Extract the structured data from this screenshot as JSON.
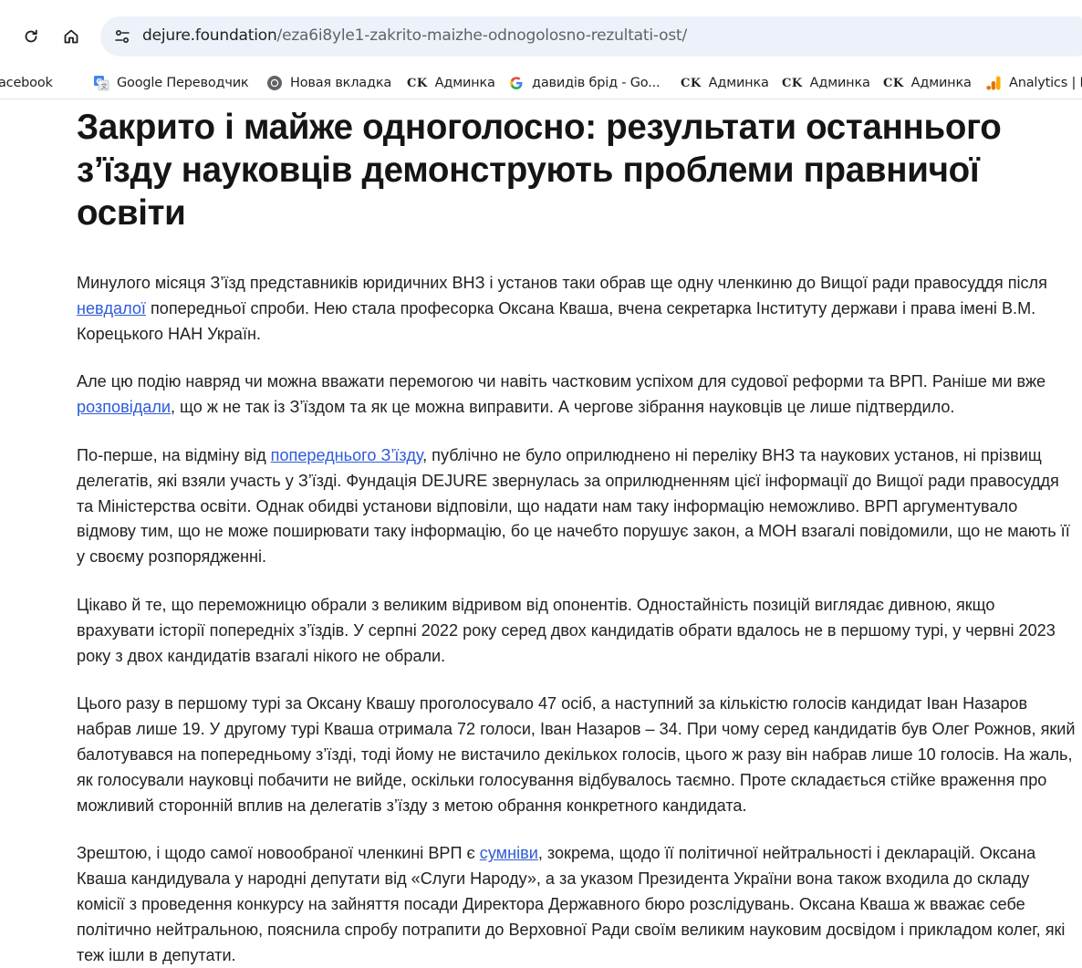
{
  "browser": {
    "url_domain": "dejure.foundation",
    "url_path": "/eza6i8yle1-zakrito-maizhe-odnogolosno-rezultati-ost/",
    "bookmarks": [
      {
        "label": "acebook",
        "icon": "facebook-icon"
      },
      {
        "label": "Google Переводчик",
        "icon": "google-translate-icon"
      },
      {
        "label": "Новая вкладка",
        "icon": "chrome-icon"
      },
      {
        "label": "Админка",
        "icon": "ck-logo-icon",
        "prefix": "CK"
      },
      {
        "label": "давидів брід - Go...",
        "icon": "google-icon"
      },
      {
        "label": "Админка",
        "icon": "ck-logo-icon",
        "prefix": "CK"
      },
      {
        "label": "Админка",
        "icon": "ck-logo-icon",
        "prefix": "CK"
      },
      {
        "label": "Админка",
        "icon": "ck-logo-icon",
        "prefix": "CK"
      },
      {
        "label": "Analytics | F",
        "icon": "analytics-icon"
      }
    ]
  },
  "article": {
    "title": "Закрито і майже одноголосно: результати останнього з’їзду науковців демонструють проблеми правничої освіти",
    "p1": {
      "before": "Минулого місяця З’їзд представників  юридичних ВНЗ і установ таки обрав ще одну членкиню до Вищої ради правосуддя після ",
      "link": "невдалої",
      "after": " попередньої спроби. Нею стала професорка Оксана Кваша, вчена секретарка Інституту держави і права імені В.М. Корецького НАН Україн."
    },
    "p2": {
      "before": "Але цю подію навряд чи можна вважати перемогою чи навіть частковим успіхом для судової реформи та ВРП. Раніше ми вже ",
      "link": "розповідали",
      "after": ", що ж не так із З’їздом та як це можна виправити. А чергове зібрання науковців це лише підтвердило."
    },
    "p3": {
      "before": "По-перше, на відміну від ",
      "link": "попереднього З’їзду",
      "after": ", публічно не було оприлюднено ні переліку ВНЗ та наукових установ, ні прізвищ делегатів, які взяли участь у З’їзді. Фундація DEJURE звернулась за оприлюдненням цієї інформації до Вищої ради правосуддя та Міністерства освіти. Однак обидві установи відповіли, що надати нам таку інформацію неможливо. ВРП аргументувало відмову тим, що не може поширювати таку інформацію, бо це начебто порушує закон, а МОН взагалі повідомили, що не мають її у своєму розпорядженні."
    },
    "p4": "Цікаво й те, що переможницю обрали з великим відривом від опонентів. Одностайність позицій виглядає дивною, якщо врахувати історії попередніх з’їздів. У серпні 2022 року серед двох кандидатів обрати вдалось не в першому турі, у червні 2023 року з двох кандидатів взагалі нікого не обрали.",
    "p5": "Цього разу в першому турі за Оксану Квашу проголосувало 47 осіб, а наступний за кількістю голосів кандидат Іван Назаров набрав лише 19. У другому турі Кваша отримала 72 голоси, Іван Назаров – 34. При чому серед кандидатів був Олег Рожнов, який балотувався на попередньому з’їзді, тоді йому не вистачило декількох голосів, цього ж разу він набрав лише 10 голосів. На жаль, як голосували науковці побачити не вийде, оскільки голосування відбувалось таємно. Проте складається стійке враження про можливий сторонній вплив на делегатів з’їзду з метою обрання конкретного кандидата.",
    "p6": {
      "before": "Зрештою, і щодо самої новообраної членкині ВРП є ",
      "link": "сумніви",
      "after": ", зокрема, щодо її політичної нейтральності і декларацій. Оксана Кваша кандидувала у народні депутати від «Слуги Народу», а за указом Президента України вона також входила до складу комісії з проведення конкурсу на зайняття посади Директора Державного бюро розслідувань. Оксана Кваша ж вважає себе політично нейтральною, пояснила спробу потрапити до Верховної Ради своїм великим науковим досвідом і прикладом колег, які теж ішли в депутати."
    }
  }
}
